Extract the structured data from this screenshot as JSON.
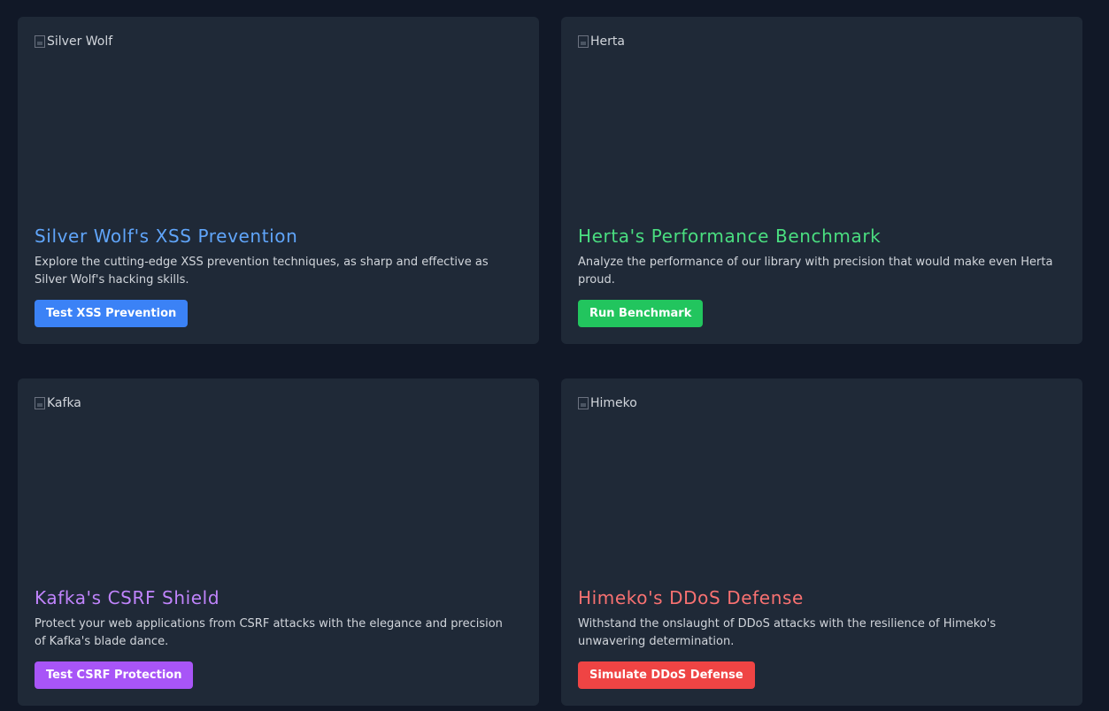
{
  "cards": [
    {
      "image_alt": "Silver Wolf",
      "title": "Silver Wolf's XSS Prevention",
      "description": "Explore the cutting-edge XSS prevention techniques, as sharp and effective as Silver Wolf's hacking skills.",
      "button_label": "Test XSS Prevention",
      "accent_color": "#60a5fa",
      "button_color": "#3b82f6"
    },
    {
      "image_alt": "Herta",
      "title": "Herta's Performance Benchmark",
      "description": "Analyze the performance of our library with precision that would make even Herta proud.",
      "button_label": "Run Benchmark",
      "accent_color": "#4ade80",
      "button_color": "#22c55e"
    },
    {
      "image_alt": "Kafka",
      "title": "Kafka's CSRF Shield",
      "description": "Protect your web applications from CSRF attacks with the elegance and precision of Kafka's blade dance.",
      "button_label": "Test CSRF Protection",
      "accent_color": "#c084fc",
      "button_color": "#a855f7"
    },
    {
      "image_alt": "Himeko",
      "title": "Himeko's DDoS Defense",
      "description": "Withstand the onslaught of DDoS attacks with the resilience of Himeko's unwavering determination.",
      "button_label": "Simulate DDoS Defense",
      "accent_color": "#f87171",
      "button_color": "#ef4444"
    }
  ]
}
